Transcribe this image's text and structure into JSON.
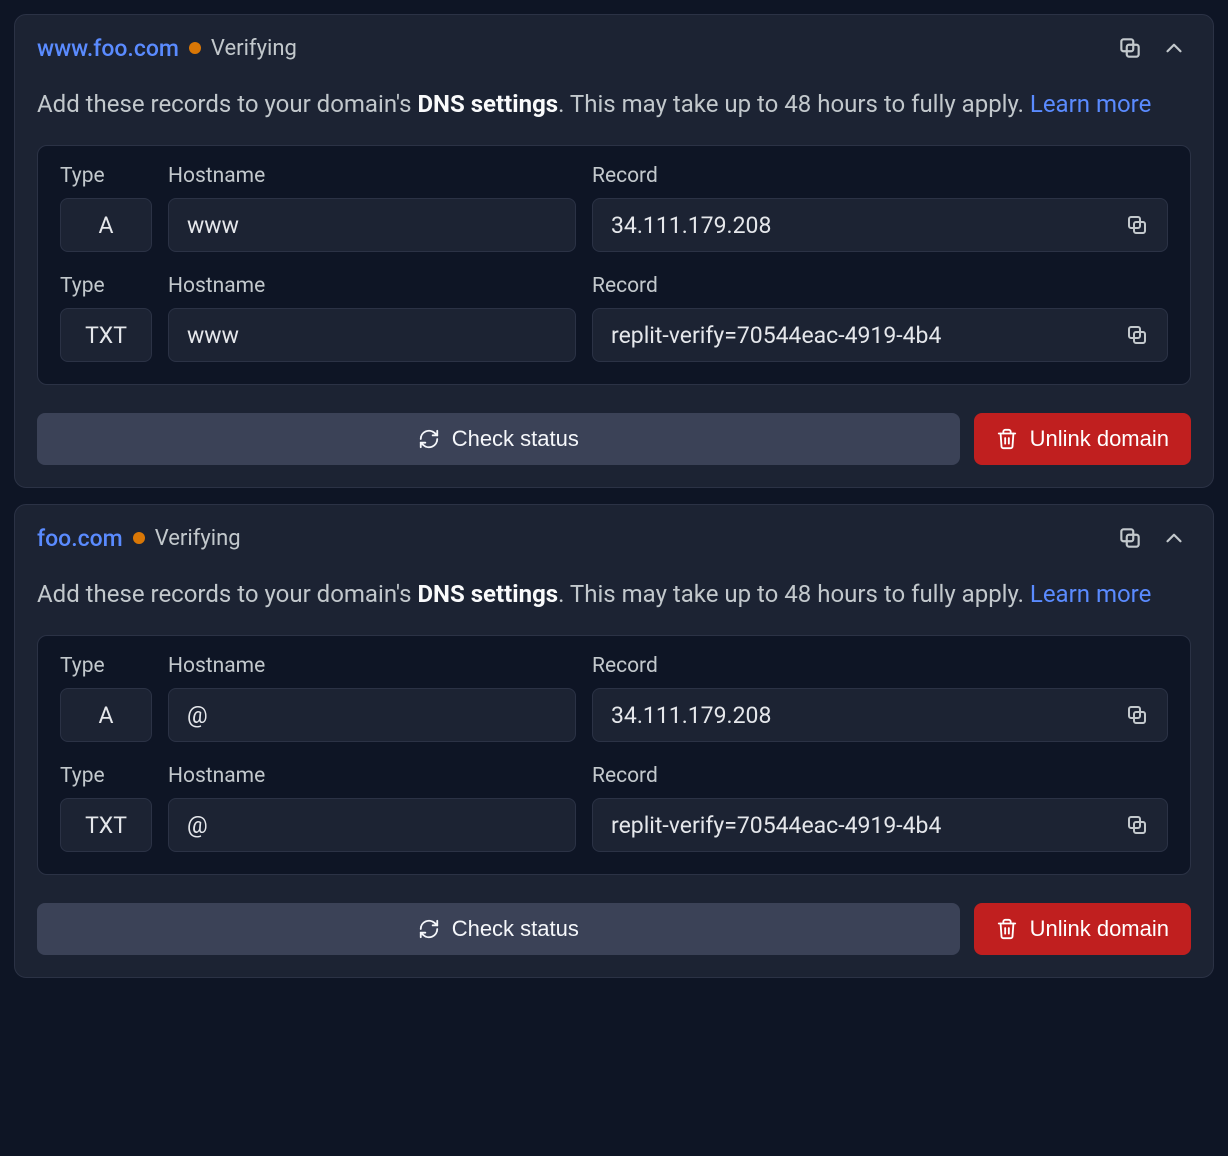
{
  "labels": {
    "type": "Type",
    "hostname": "Hostname",
    "record": "Record"
  },
  "instructions": {
    "prefix": "Add these records to your domain's ",
    "bold": "DNS settings",
    "suffix": ". This may take up to 48 hours to fully apply. ",
    "learn_more": "Learn more"
  },
  "buttons": {
    "check_status": "Check status",
    "unlink_domain": "Unlink domain"
  },
  "domains": [
    {
      "name": "www.foo.com",
      "status": "Verifying",
      "records": [
        {
          "type": "A",
          "hostname": "www",
          "record": "34.111.179.208"
        },
        {
          "type": "TXT",
          "hostname": "www",
          "record": "replit-verify=70544eac-4919-4b4"
        }
      ]
    },
    {
      "name": "foo.com",
      "status": "Verifying",
      "records": [
        {
          "type": "A",
          "hostname": "@",
          "record": "34.111.179.208"
        },
        {
          "type": "TXT",
          "hostname": "@",
          "record": "replit-verify=70544eac-4919-4b4"
        }
      ]
    }
  ]
}
